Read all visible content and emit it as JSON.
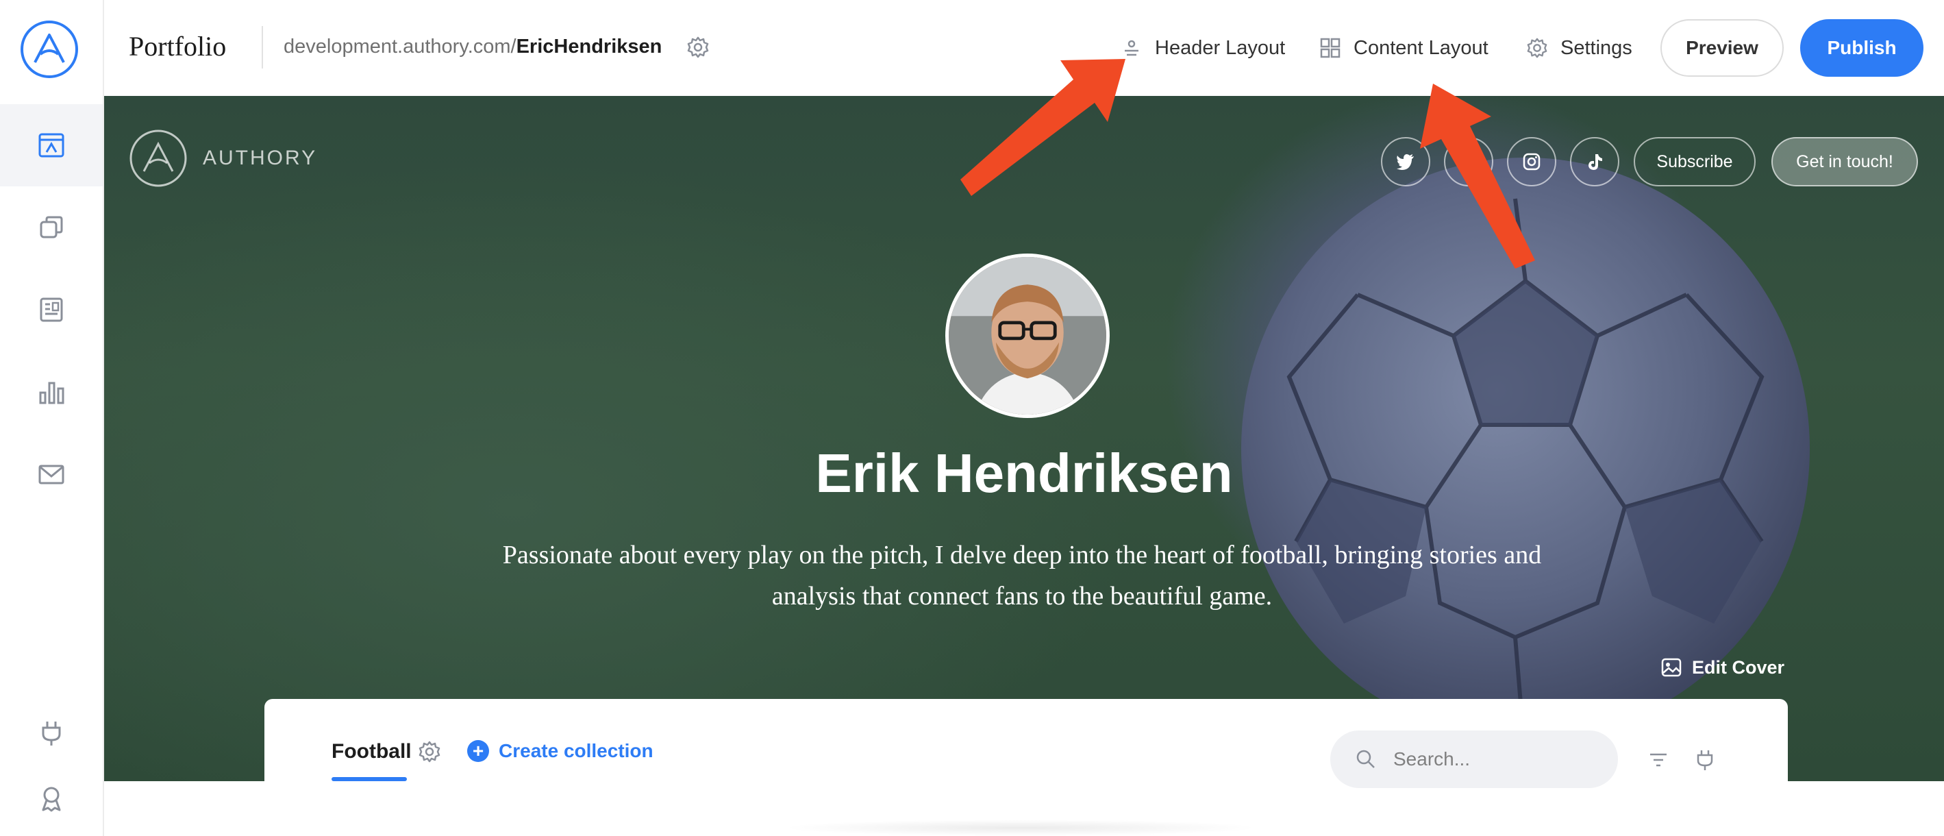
{
  "sidebar": {
    "logo_icon": "authory-logo-icon",
    "items": [
      {
        "icon": "portfolio-icon",
        "active": true
      },
      {
        "icon": "collections-icon",
        "active": false
      },
      {
        "icon": "articles-icon",
        "active": false
      },
      {
        "icon": "analytics-icon",
        "active": false
      },
      {
        "icon": "mail-icon",
        "active": false
      },
      {
        "icon": "plug-icon",
        "active": false
      },
      {
        "icon": "badge-icon",
        "active": false
      }
    ]
  },
  "topbar": {
    "title": "Portfolio",
    "url_prefix": "development.authory.com/",
    "url_user": "EricHendriksen",
    "header_layout": "Header Layout",
    "content_layout": "Content Layout",
    "settings": "Settings",
    "preview": "Preview",
    "publish": "Publish",
    "accent_color": "#2d7cf5"
  },
  "hero": {
    "brand": "AUTHORY",
    "social": [
      "twitter-icon",
      "link-icon",
      "instagram-icon",
      "tiktok-icon"
    ],
    "subscribe": "Subscribe",
    "get_in_touch": "Get in touch!",
    "name": "Erik Hendriksen",
    "bio": "Passionate about every play on the pitch, I delve deep into the heart of football, bringing stories and analysis that connect fans to the beautiful game.",
    "edit_cover": "Edit Cover"
  },
  "content": {
    "tab": "Football",
    "create_collection": "Create collection",
    "search_placeholder": "Search..."
  },
  "annotations": {
    "arrow_color": "#f04a24"
  }
}
